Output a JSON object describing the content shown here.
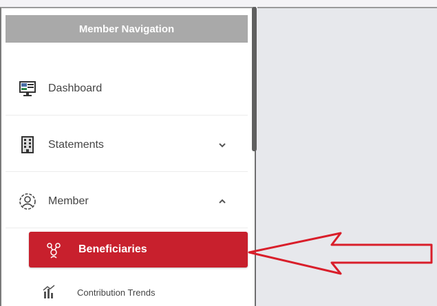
{
  "sidebar": {
    "header": "Member Navigation",
    "items": [
      {
        "label": "Dashboard",
        "icon": "dashboard-monitor-icon"
      },
      {
        "label": "Statements",
        "icon": "statements-building-icon",
        "chevron": "down"
      },
      {
        "label": "Member",
        "icon": "member-user-icon",
        "chevron": "up"
      }
    ],
    "subitems": [
      {
        "label": "Beneficiaries",
        "icon": "beneficiaries-icon",
        "active": true
      },
      {
        "label": "Contribution Trends",
        "icon": "contribution-trends-icon"
      }
    ]
  },
  "annotation": {
    "color": "#d91e2a",
    "points_to": "Beneficiaries"
  },
  "colors": {
    "accent": "#c8202d",
    "header_bg": "#a9a9a9"
  }
}
